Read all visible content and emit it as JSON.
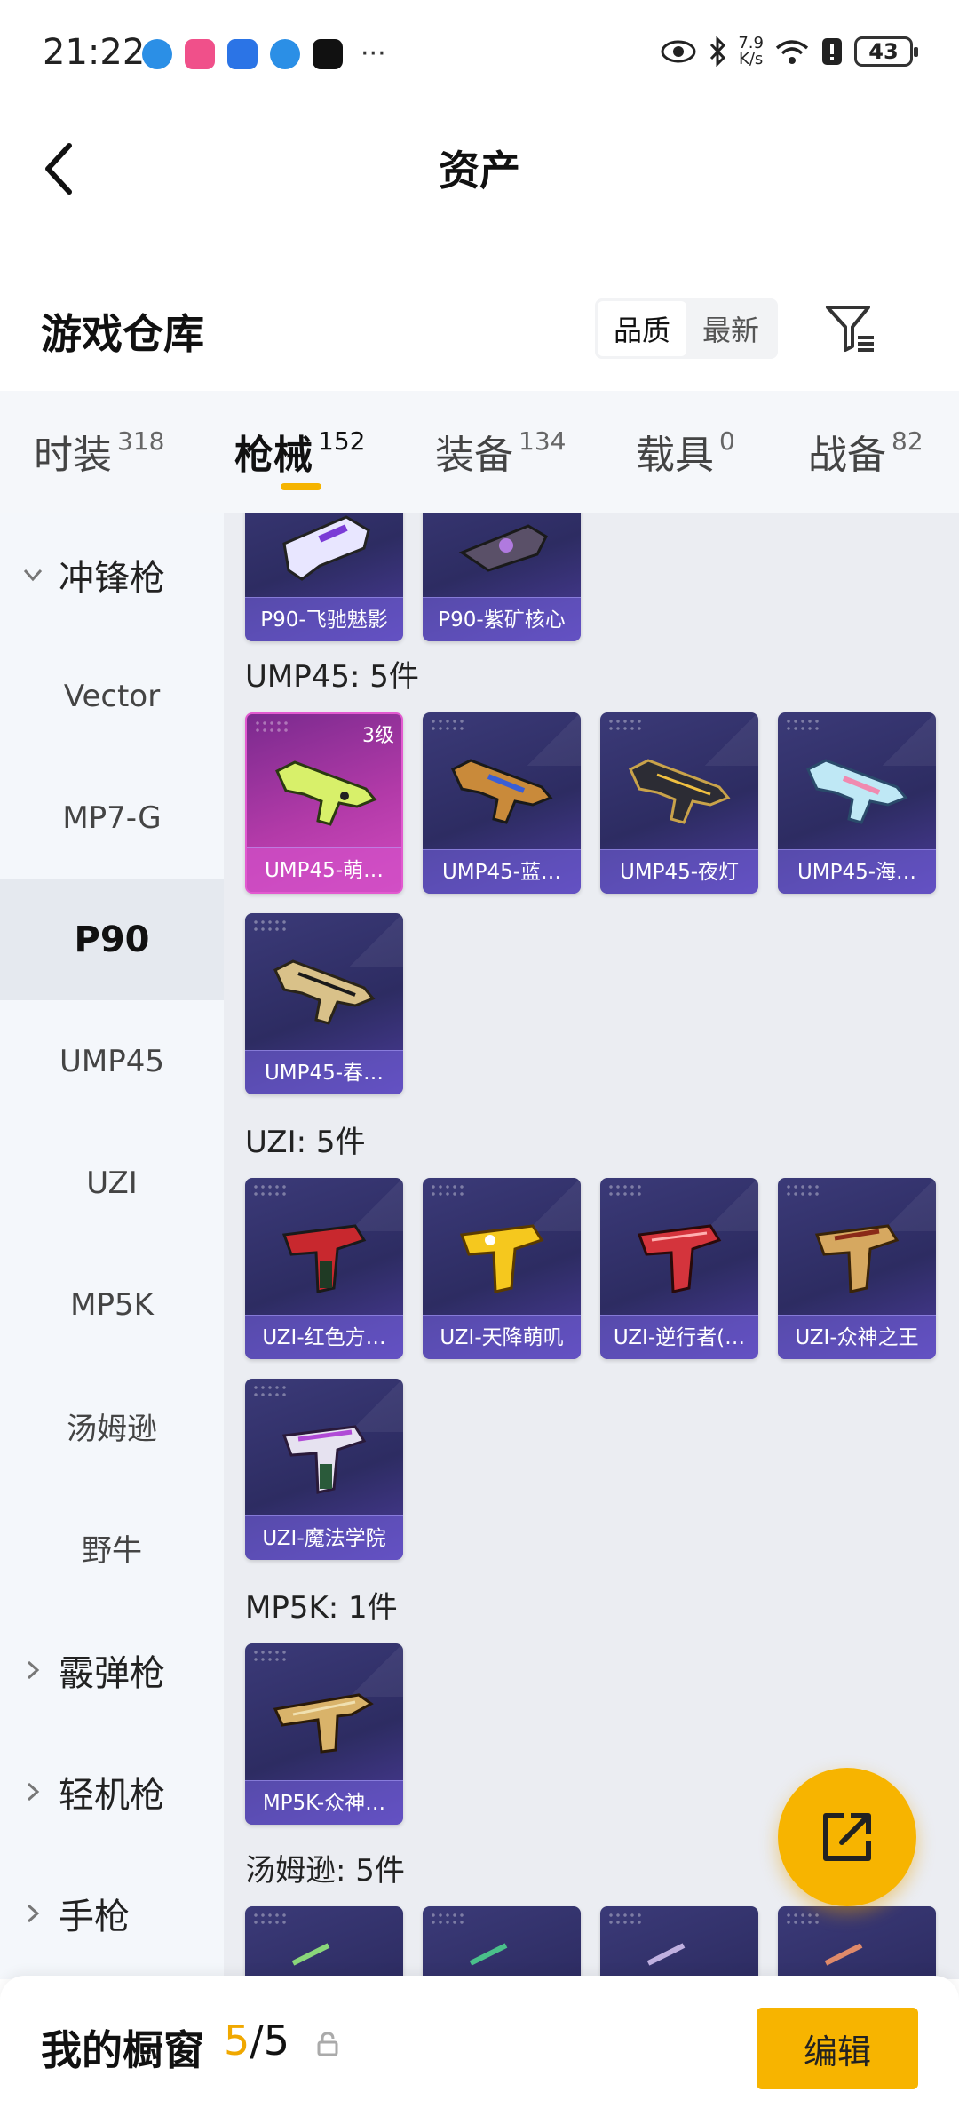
{
  "status_bar": {
    "time": "21:22",
    "more": "···",
    "net_speed_value": "7.9",
    "net_speed_unit": "K/s",
    "battery": "43"
  },
  "header": {
    "title": "资产"
  },
  "warehouse": {
    "title": "游戏仓库",
    "sort_options": [
      "品质",
      "最新"
    ],
    "active_sort": "品质"
  },
  "tabs": [
    {
      "label": "时装",
      "count": "318"
    },
    {
      "label": "枪械",
      "count": "152",
      "active": true
    },
    {
      "label": "装备",
      "count": "134"
    },
    {
      "label": "载具",
      "count": "0"
    },
    {
      "label": "战备",
      "count": "82"
    }
  ],
  "sidebar": {
    "group_open": "冲锋枪",
    "items": [
      "Vector",
      "MP7-G",
      "P90",
      "UMP45",
      "UZI",
      "MP5K",
      "汤姆逊",
      "野牛"
    ],
    "active_item": "P90",
    "groups_collapsed": [
      "霰弹枪",
      "轻机枪",
      "手枪"
    ]
  },
  "content": {
    "p90_cards": [
      "P90-飞驰魅影",
      "P90-紫矿核心"
    ],
    "ump45": {
      "title": "UMP45: 5件",
      "cards": [
        {
          "label": "UMP45-萌…",
          "level": "3级"
        },
        {
          "label": "UMP45-蓝…"
        },
        {
          "label": "UMP45-夜灯"
        },
        {
          "label": "UMP45-海…"
        },
        {
          "label": "UMP45-春…"
        }
      ]
    },
    "uzi": {
      "title": "UZI: 5件",
      "cards": [
        "UZI-红色方…",
        "UZI-天降萌叽",
        "UZI-逆行者(…",
        "UZI-众神之王",
        "UZI-魔法学院"
      ]
    },
    "mp5k": {
      "title": "MP5K: 1件",
      "cards": [
        "MP5K-众神…"
      ]
    },
    "thompson": {
      "title": "汤姆逊: 5件"
    }
  },
  "bottom_bar": {
    "title": "我的橱窗",
    "count_current": "5",
    "count_total": "/5",
    "edit_label": "编辑"
  },
  "colors": {
    "accent": "#f7b400",
    "card_bg": "#2d2c62",
    "card_label": "#7864e6",
    "card_pink": "#b23aa8"
  }
}
